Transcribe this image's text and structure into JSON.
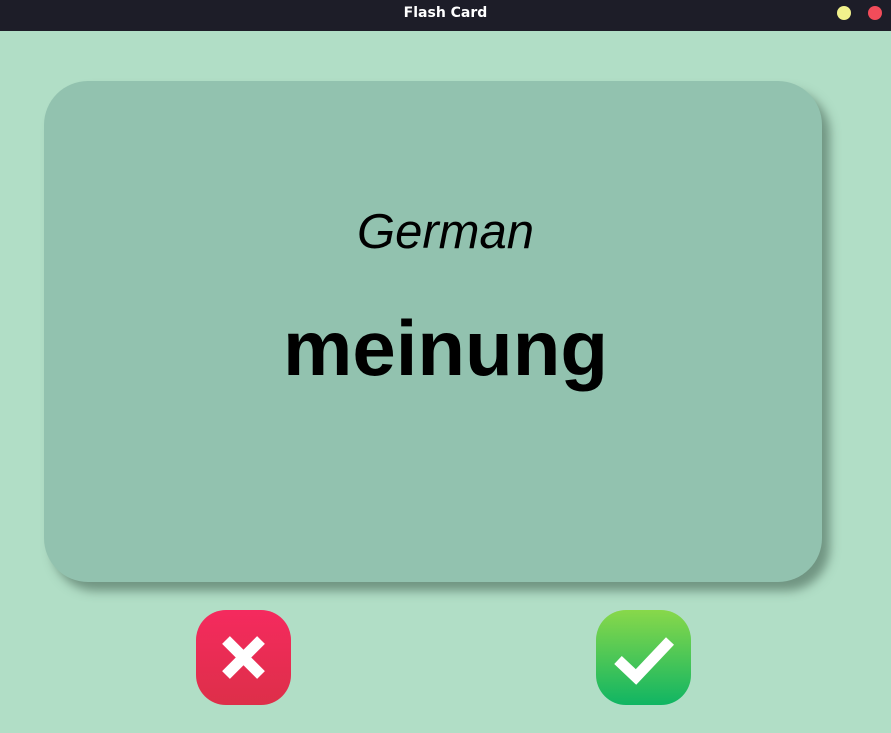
{
  "window": {
    "title": "Flash Card",
    "controls": [
      "minimize-icon",
      "close-icon"
    ]
  },
  "card": {
    "title": "German",
    "word": "meinung"
  },
  "actions": {
    "wrong_icon": "cross-icon",
    "right_icon": "check-icon"
  },
  "colors": {
    "background": "#b1dec6",
    "card": "#92c2af",
    "titlebar": "#1d1d28",
    "wrong_button": "#e9304f",
    "right_button": "#4cc758"
  }
}
